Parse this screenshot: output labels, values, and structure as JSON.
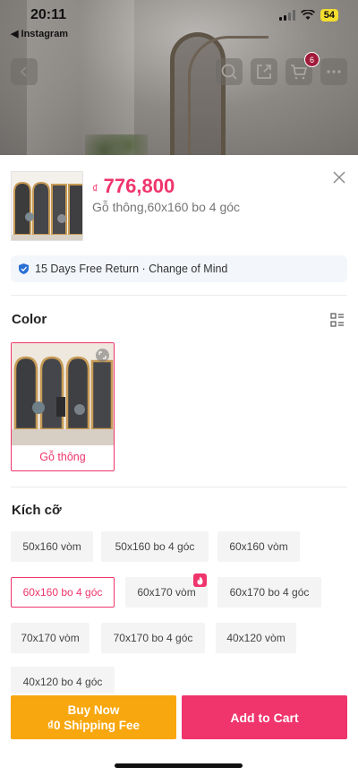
{
  "status_bar": {
    "time": "20:11",
    "back_app": "◀ Instagram",
    "battery": "54"
  },
  "header_nav": {
    "cart_count": "6",
    "icons": [
      "back-icon",
      "search-icon",
      "share-icon",
      "cart-icon",
      "more-icon"
    ]
  },
  "product": {
    "currency": "₫",
    "price": "776,800",
    "selected_variant": "Gỗ thông,60x160 bo 4 góc"
  },
  "return_policy": {
    "text": "15 Days Free Return · Change of Mind"
  },
  "color_section": {
    "title": "Color",
    "options": [
      {
        "label": "Gỗ thông",
        "selected": true
      }
    ]
  },
  "size_section": {
    "title": "Kích cỡ",
    "options": [
      {
        "label": "50x160 vòm",
        "selected": false
      },
      {
        "label": "50x160 bo 4 góc",
        "selected": false
      },
      {
        "label": "60x160 vòm",
        "selected": false
      },
      {
        "label": "60x160 bo 4 góc",
        "selected": true
      },
      {
        "label": "60x170 vòm",
        "selected": false,
        "hot": true
      },
      {
        "label": "60x170 bo 4 góc",
        "selected": false
      },
      {
        "label": "70x170 vòm",
        "selected": false
      },
      {
        "label": "70x170 bo 4 góc",
        "selected": false
      },
      {
        "label": "40x120 vòm",
        "selected": false
      },
      {
        "label": "40x120 bo 4 góc",
        "selected": false
      }
    ]
  },
  "actions": {
    "buy_now_line1": "Buy Now",
    "buy_now_line2": "₫0 Shipping Fee",
    "add_to_cart": "Add to Cart"
  },
  "colors": {
    "accent": "#f0346c",
    "buy_now": "#f8a70f",
    "badge": "#a11a3a"
  }
}
